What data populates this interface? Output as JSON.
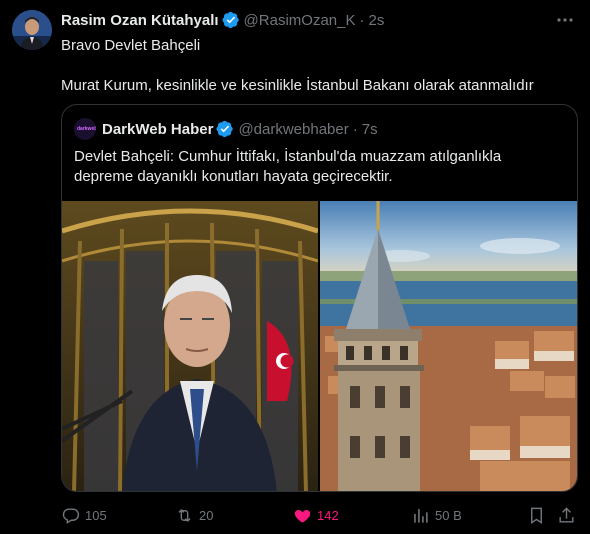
{
  "author": {
    "name": "Rasim Ozan Kütahyalı",
    "handle": "@RasimOzan_K",
    "separator": "·",
    "time": "2s"
  },
  "tweet": {
    "line1": "Bravo Devlet Bahçeli",
    "line2": "Murat Kurum, kesinlikle ve kesinlikle İstanbul Bakanı olarak atanmalıdır"
  },
  "quote": {
    "name": "DarkWeb Haber",
    "handle": "@darkwebhaber",
    "separator": "·",
    "time": "7s",
    "avatar_text": "darkweb",
    "text": "Devlet Bahçeli: Cumhur İttifakı, İstanbul'da muazzam atılganlıkla depreme dayanıklı konutları hayata geçirecektir."
  },
  "actions": {
    "replies": "105",
    "retweets": "20",
    "likes": "142",
    "views": "50 B"
  },
  "colors": {
    "background": "#000000",
    "verified": "#1d9bf0",
    "like": "#f91880",
    "muted": "#71767b"
  },
  "icons": [
    "more-icon",
    "verified-icon",
    "reply-icon",
    "retweet-icon",
    "like-icon",
    "views-icon",
    "bookmark-icon",
    "share-icon"
  ]
}
